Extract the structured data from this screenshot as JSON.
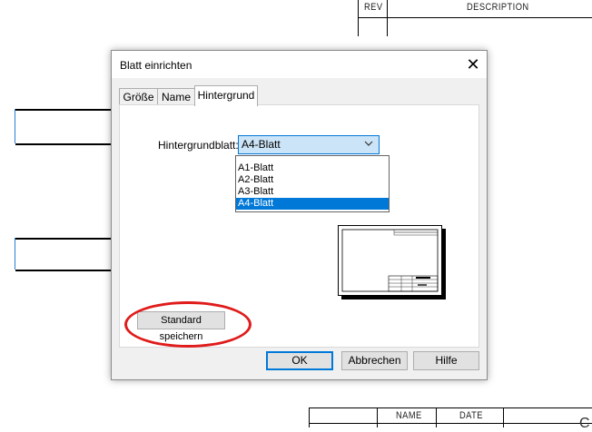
{
  "background_drawing": {
    "rev_table": {
      "rev_header": "REV",
      "description_header": "DESCRIPTION"
    },
    "title_table": {
      "name_header": "NAME",
      "date_header": "DATE"
    },
    "edge_letter": "C"
  },
  "dialog": {
    "title": "Blatt einrichten",
    "close_glyph": "✕",
    "tabs": [
      {
        "label": "Größe",
        "active": false
      },
      {
        "label": "Name",
        "active": false
      },
      {
        "label": "Hintergrund",
        "active": true
      }
    ],
    "background_field": {
      "label": "Hintergrundblatt:",
      "selected": "A4-Blatt",
      "options": [
        "A1-Blatt",
        "A2-Blatt",
        "A3-Blatt",
        "A4-Blatt"
      ],
      "highlighted_option": "A4-Blatt"
    },
    "save_default_button": "Standard speichern",
    "footer": {
      "ok": "OK",
      "cancel": "Abbrechen",
      "help": "Hilfe"
    }
  },
  "colors": {
    "accent": "#0078d7",
    "highlight_ring": "#e01b1b",
    "select_bg": "#cce4f7"
  }
}
